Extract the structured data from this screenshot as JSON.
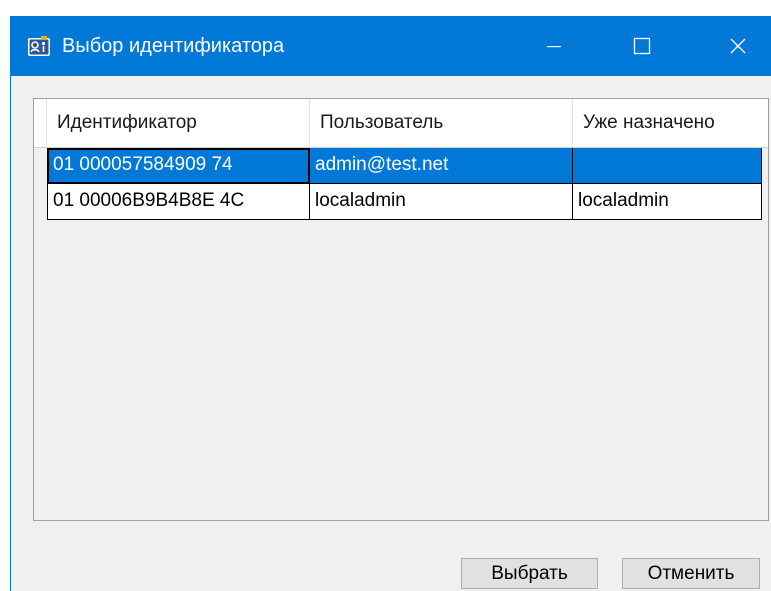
{
  "window": {
    "title": "Выбор идентификатора",
    "app_icon": "id-card-icon",
    "accent_color": "#0078d7",
    "controls": {
      "minimize": "minimize-icon",
      "maximize": "maximize-icon",
      "close": "close-icon"
    }
  },
  "table": {
    "columns": [
      "Идентификатор",
      "Пользователь",
      "Уже назначено"
    ],
    "rows": [
      {
        "id": "01 000057584909 74",
        "user": "admin@test.net",
        "assigned": "",
        "selected": true
      },
      {
        "id": "01 00006B9B4B8E 4C",
        "user": "localadmin",
        "assigned": "localadmin",
        "selected": false
      }
    ]
  },
  "buttons": {
    "select_label": "Выбрать",
    "cancel_label": "Отменить"
  }
}
